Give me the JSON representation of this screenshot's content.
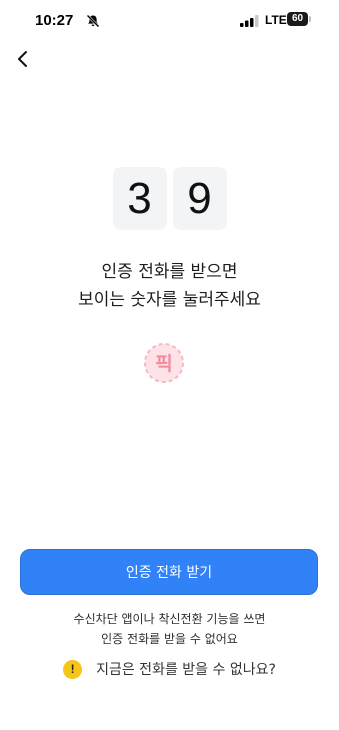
{
  "status_bar": {
    "time": "10:27",
    "network": "LTE",
    "battery": "60"
  },
  "verification": {
    "digits": [
      "3",
      "9"
    ],
    "instruction_line1": "인증 전화를 받으면",
    "instruction_line2": "보이는 숫자를 눌러주세요",
    "watermark_text": "픽"
  },
  "call_button": {
    "label": "인증 전화 받기"
  },
  "notice": {
    "line1": "수신차단 앱이나 착신전환 기능을 쓰면",
    "line2": "인증 전화를 받을 수 없어요"
  },
  "help": {
    "icon_glyph": "!",
    "label": "지금은 전화를 받을 수 없나요?"
  },
  "colors": {
    "primary": "#3182f6",
    "digit_bg": "#f3f4f6",
    "warning": "#f5c518"
  }
}
